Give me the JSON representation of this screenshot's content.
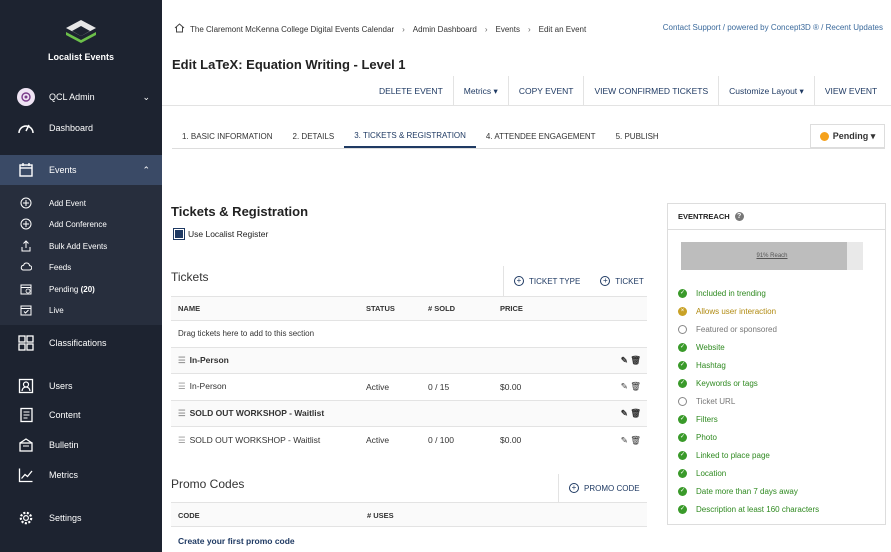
{
  "sidebar": {
    "brand": "Localist Events",
    "user": "QCL Admin",
    "items": [
      {
        "label": "Dashboard",
        "icon": "speedometer-icon"
      },
      {
        "label": "Events",
        "icon": "calendar-icon"
      },
      {
        "label": "Classifications",
        "icon": "grid-icon"
      },
      {
        "label": "Users",
        "icon": "user-icon"
      },
      {
        "label": "Content",
        "icon": "document-icon"
      },
      {
        "label": "Bulletin",
        "icon": "bulletin-icon"
      },
      {
        "label": "Metrics",
        "icon": "chart-icon"
      },
      {
        "label": "Settings",
        "icon": "gear-icon"
      }
    ],
    "sub_items": [
      {
        "label": "Add Event"
      },
      {
        "label": "Add Conference"
      },
      {
        "label": "Bulk Add Events"
      },
      {
        "label": "Feeds"
      },
      {
        "label": "Pending",
        "count": "(20)"
      },
      {
        "label": "Live"
      }
    ]
  },
  "header": {
    "breadcrumbs": [
      "The Claremont McKenna College Digital Events Calendar",
      "Admin Dashboard",
      "Events",
      "Edit an Event"
    ],
    "breadcrumb_sep": "›",
    "support": "Contact Support / powered by Concept3D ® / Recent Updates"
  },
  "page_title": "Edit LaTeX: Equation Writing - Level 1",
  "actions": [
    "DELETE EVENT",
    "Metrics",
    "COPY EVENT",
    "VIEW CONFIRMED TICKETS",
    "Customize Layout",
    "VIEW EVENT"
  ],
  "tabs": [
    "1. BASIC INFORMATION",
    "2. DETAILS",
    "3. TICKETS & REGISTRATION",
    "4. ATTENDEE ENGAGEMENT",
    "5. PUBLISH"
  ],
  "status": {
    "label": "Pending",
    "color": "#f5a11c"
  },
  "section_title": "Tickets & Registration",
  "use_register_label": "Use Localist Register",
  "tickets": {
    "heading": "Tickets",
    "btn_type": "TICKET TYPE",
    "btn_ticket": "TICKET",
    "columns": [
      "NAME",
      "STATUS",
      "# SOLD",
      "PRICE"
    ],
    "drag_hint": "Drag tickets here to add to this section",
    "groups": [
      {
        "name": "In-Person",
        "tickets": [
          {
            "name": "In-Person",
            "status": "Active",
            "sold": "0 / 15",
            "price": "$0.00"
          }
        ]
      },
      {
        "name": "SOLD OUT WORKSHOP - Waitlist",
        "tickets": [
          {
            "name": "SOLD OUT WORKSHOP - Waitlist",
            "status": "Active",
            "sold": "0 / 100",
            "price": "$0.00"
          }
        ]
      }
    ]
  },
  "promo": {
    "heading": "Promo Codes",
    "btn": "PROMO CODE",
    "columns": [
      "CODE",
      "# USES"
    ],
    "create_link": "Create your first promo code"
  },
  "eventreach": {
    "title": "EVENTREACH",
    "reach_label": "91% Reach",
    "reach_fraction": 0.91,
    "items": [
      {
        "label": "Included in trending",
        "state": "ok"
      },
      {
        "label": "Allows user interaction",
        "state": "warn"
      },
      {
        "label": "Featured or sponsored",
        "state": "none"
      },
      {
        "label": "Website",
        "state": "ok"
      },
      {
        "label": "Hashtag",
        "state": "ok"
      },
      {
        "label": "Keywords or tags",
        "state": "ok"
      },
      {
        "label": "Ticket URL",
        "state": "none"
      },
      {
        "label": "Filters",
        "state": "ok"
      },
      {
        "label": "Photo",
        "state": "ok"
      },
      {
        "label": "Linked to place page",
        "state": "ok"
      },
      {
        "label": "Location",
        "state": "ok"
      },
      {
        "label": "Date more than 7 days away",
        "state": "ok"
      },
      {
        "label": "Description at least 160 characters",
        "state": "ok"
      }
    ]
  }
}
